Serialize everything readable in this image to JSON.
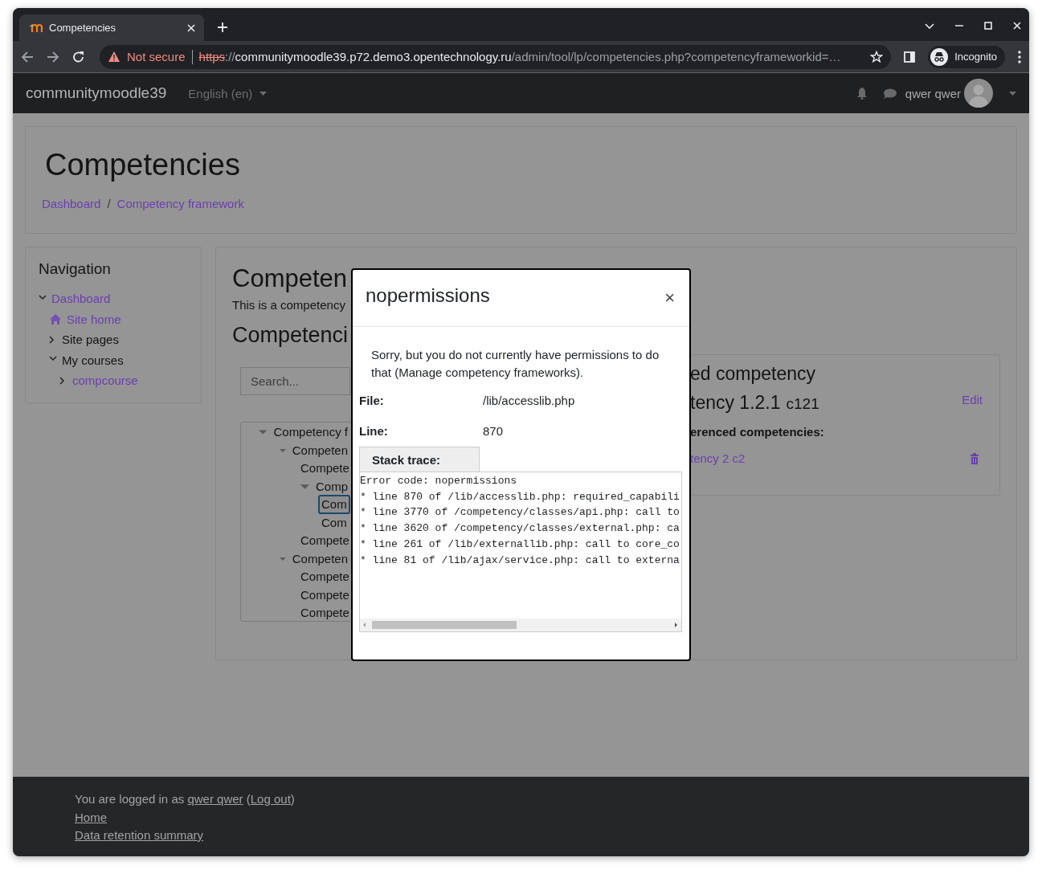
{
  "browser": {
    "tab_title": "Competencies",
    "security": "Not secure",
    "url": {
      "scheme": "https",
      "separator": "://",
      "host": "communitymoodle39.p72.demo3.opentechnology.ru",
      "path": "/admin/tool/lp/competencies.php?competencyframeworkid=…"
    },
    "profile": "Incognito"
  },
  "navbar": {
    "site_name": "communitymoodle39",
    "language": "English (en)",
    "user_name": "qwer qwer"
  },
  "header": {
    "title": "Competencies",
    "breadcrumbs": [
      "Dashboard",
      "Competency framework"
    ],
    "separator": "/"
  },
  "navigation": {
    "title": "Navigation",
    "items": [
      {
        "label": "Dashboard",
        "kind": "branch",
        "link": true,
        "expanded": true,
        "children": [
          {
            "label": "Site home",
            "kind": "home",
            "link": true
          },
          {
            "label": "Site pages",
            "kind": "branch",
            "link": false,
            "expanded": false
          },
          {
            "label": "My courses",
            "kind": "branch",
            "link": false,
            "expanded": true,
            "children": [
              {
                "label": "compcourse",
                "kind": "branch",
                "link": true,
                "expanded": false
              }
            ]
          }
        ]
      }
    ]
  },
  "framework": {
    "title": "Competen",
    "description": "This is a competency",
    "section_title": "Competenci",
    "search_placeholder": "Search...",
    "tree": [
      {
        "label": "Competency f",
        "selected": false,
        "expanded": true,
        "children": [
          {
            "label": "Competen",
            "selected": false,
            "expanded": true,
            "children": [
              {
                "label": "Compete",
                "selected": false
              },
              {
                "label": "Comp",
                "selected": false,
                "expanded": true,
                "children": [
                  {
                    "label": "Com",
                    "selected": true
                  },
                  {
                    "label": "Com",
                    "selected": false
                  }
                ]
              },
              {
                "label": "Compete",
                "selected": false
              }
            ]
          },
          {
            "label": "Competen",
            "selected": false,
            "expanded": true,
            "children": [
              {
                "label": "Compete",
                "selected": false
              },
              {
                "label": "Compete",
                "selected": false
              },
              {
                "label": "Compete",
                "selected": false
              }
            ]
          }
        ]
      }
    ]
  },
  "selected_competency": {
    "heading": "ed competency",
    "name": "tency 1.2.1",
    "idnumber": "c121",
    "edit": "Edit",
    "related_heading": "erenced competencies:",
    "related": [
      {
        "label": "tency 2 c2"
      }
    ]
  },
  "modal": {
    "title": "nopermissions",
    "close": "×",
    "message": "Sorry, but you do not currently have permissions to do that (Manage competency frameworks).",
    "fields": [
      {
        "label": "File:",
        "value": "/lib/accesslib.php"
      },
      {
        "label": "Line:",
        "value": "870"
      }
    ],
    "stack_trace_button": "Stack trace:",
    "stack_trace": [
      "Error code: nopermissions",
      "* line 870 of /lib/accesslib.php: required_capabili",
      "* line 3770 of /competency/classes/api.php: call to",
      "* line 3620 of /competency/classes/external.php: ca",
      "* line 261 of /lib/externallib.php: call to core_co",
      "* line 81 of /lib/ajax/service.php: call to externa"
    ]
  },
  "footer": {
    "login": {
      "prefix": "You are logged in as",
      "user": "qwer qwer",
      "open": "(",
      "logout": "Log out",
      "close": ")"
    },
    "links": [
      "Home",
      "Data retention summary"
    ]
  }
}
